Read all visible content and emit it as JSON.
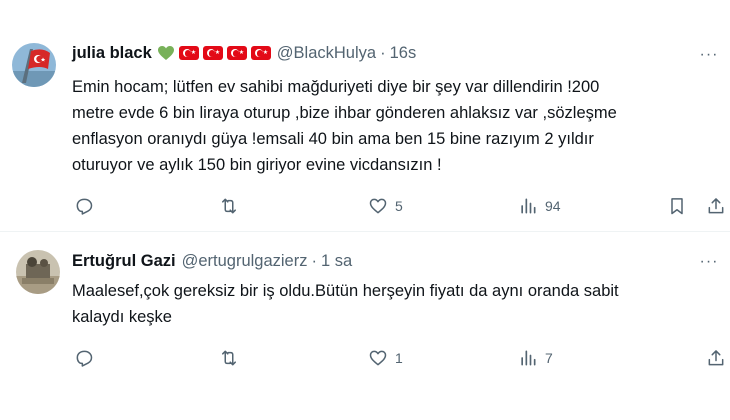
{
  "tweets": [
    {
      "display_name": "julia black",
      "handle": "@BlackHulya",
      "separator": "·",
      "time": "16s",
      "text": "Emin hocam; lütfen ev sahibi mağduriyeti diye bir şey var dillendirin !200\nmetre evde 6 bin liraya oturup ,bize ihbar gönderen ahlaksız var ,sözleşme\nenflasyon oranıydı güya !emsali 40 bin ama ben 15 bine razıyım 2 yıldır\noturuyor ve aylık 150 bin giriyor evine vicdansızın !",
      "more_label": "···",
      "reply_count": "",
      "retweet_count": "",
      "like_count": "5",
      "view_count": "94",
      "name_emoji": [
        "green-heart-icon",
        "turkey-flag-icon",
        "turkey-flag-icon",
        "turkey-flag-icon",
        "turkey-flag-icon"
      ],
      "heart_color": "#78b159",
      "flag_color": "#e30a17"
    },
    {
      "display_name": "Ertuğrul Gazi",
      "handle": "@ertugrulgazierz",
      "separator": "·",
      "time": "1 sa",
      "text": "Maalesef,çok gereksiz bir iş oldu.Bütün herşeyin fiyatı da aynı oranda sabit\nkalaydı keşke",
      "more_label": "···",
      "reply_count": "",
      "retweet_count": "",
      "like_count": "1",
      "view_count": "7"
    }
  ],
  "colors": {
    "text_primary": "#0f1419",
    "text_secondary": "#536471",
    "divider": "#eff3f4"
  }
}
